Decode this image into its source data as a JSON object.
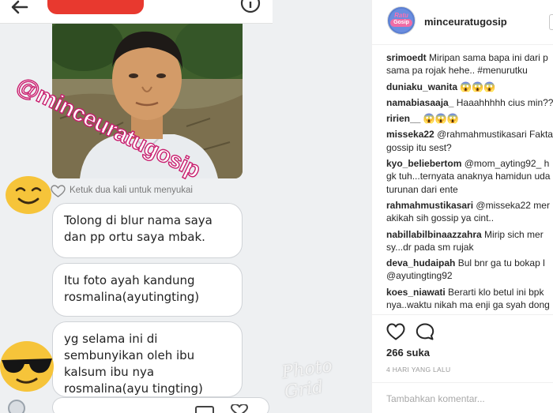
{
  "post": {
    "handle_watermark": "@minceuratugosip",
    "tap_hint": "Ketuk dua kali untuk menyukai",
    "messages": [
      "Tolong di blur nama saya\ndan pp ortu saya mbak.",
      "Itu foto ayah kandung\nrosmalina(ayutingting)",
      "yg selama ini di\nsembunyikan oleh ibu\nkalsum ibu nya\nrosmalina(ayu tingting)"
    ],
    "photo_watermark": "Photo Grid",
    "icons": [
      "back-arrow-icon",
      "info-icon",
      "smiling-emoji-icon",
      "sunglasses-emoji-icon",
      "heart-outline-icon",
      "gallery-icon"
    ]
  },
  "panel": {
    "account": {
      "username": "minceuratugosip",
      "avatar_line1": "Ratu",
      "avatar_line2": "Gosip"
    },
    "comments": [
      {
        "user": "srimoedt",
        "text": "Miripan sama bapa ini dari p",
        "cont": "sama pa rojak hehe.. #menurutku"
      },
      {
        "user": "duniaku_wanita",
        "text": "😱😱😱",
        "cont": ""
      },
      {
        "user": "namabiasaaja_",
        "text": "Haaahhhhh cius min??",
        "cont": ""
      },
      {
        "user": "ririen__",
        "text": "😱😱😱",
        "cont": ""
      },
      {
        "user": "misseka22",
        "text": "@rahmahmustikasari Fakta",
        "cont": "gossip itu sest?"
      },
      {
        "user": "kyo_beliebertom",
        "text": "@mom_ayting92_ h",
        "cont": "gk tuh...ternyata anaknya hamidun uda\nturunan dari ente"
      },
      {
        "user": "rahmahmustikasari",
        "text": "@misseka22 mer",
        "cont": "akikah sih gossip ya cint.."
      },
      {
        "user": "nabillabilbinaazzahra",
        "text": "Mirip sich mer",
        "cont": "sy...dr pada sm rujak"
      },
      {
        "user": "deva_hudaipah",
        "text": "Bul bnr ga tu bokap l",
        "cont": "@ayutingting92"
      },
      {
        "user": "koes_niawati",
        "text": "Berarti klo betul ini bpk",
        "cont": "nya..waktu nikah ma enji ga syah dong"
      }
    ],
    "likes": "266 suka",
    "timestamp": "4 HARI YANG LALU",
    "comment_placeholder": "Tambahkan komentar...",
    "icons": [
      "heart-icon",
      "comment-bubble-icon"
    ],
    "colors": {
      "link": "#003569",
      "muted": "#999999",
      "redaction": "#e8392f"
    }
  }
}
